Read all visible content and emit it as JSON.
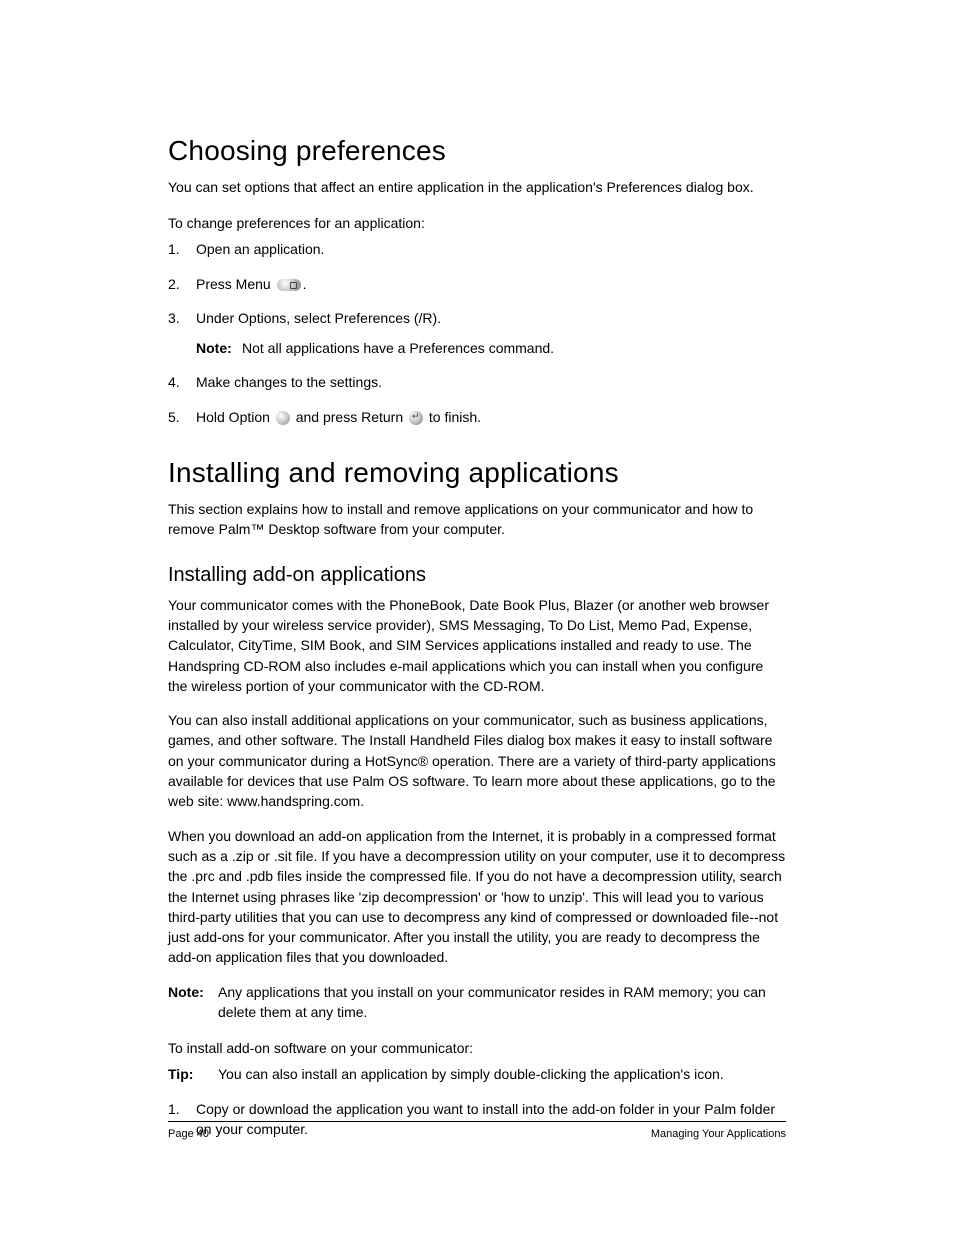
{
  "section1": {
    "heading": "Choosing preferences",
    "intro": "You can set options that affect an entire application in the application's Preferences dialog box.",
    "proc_head": "To change preferences for an application:",
    "steps": {
      "s1": {
        "num": "1.",
        "text": "Open an application."
      },
      "s2": {
        "num": "2.",
        "pre": "Press Menu ",
        "post": "."
      },
      "s3": {
        "num": "3.",
        "text": "Under Options, select Preferences (/R).",
        "note_label": "Note:",
        "note_text": "Not all applications have a Preferences command."
      },
      "s4": {
        "num": "4.",
        "text": "Make changes to the settings."
      },
      "s5": {
        "num": "5.",
        "pre": "Hold Option ",
        "mid": " and press Return ",
        "post": " to finish."
      }
    }
  },
  "section2": {
    "heading": "Installing and removing applications",
    "intro": "This section explains how to install and remove applications on your communicator and how to remove Palm™ Desktop software from your computer.",
    "sub1": {
      "heading": "Installing add-on applications",
      "p1": "Your communicator comes with the PhoneBook, Date Book Plus, Blazer (or another web browser installed by your wireless service provider), SMS Messaging, To Do List, Memo Pad, Expense, Calculator, CityTime, SIM Book, and SIM Services applications installed and ready to use. The Handspring CD-ROM also includes e-mail applications which you can install when you configure the wireless portion of your communicator with the CD-ROM.",
      "p2": "You can also install additional applications on your communicator, such as business applications, games, and other software. The Install Handheld Files dialog box makes it easy to install software on your communicator during a HotSync® operation. There are a variety of third-party applications available for devices that use Palm OS software. To learn more about these applications, go to the web site: www.handspring.com.",
      "p3": "When you download an add-on application from the Internet, it is probably in a compressed format such as a .zip or .sit file. If you have a decompression utility on your computer, use it to decompress the .prc and .pdb files inside the compressed file. If you do not have a decompression utility, search the Internet using phrases like 'zip decompression' or 'how to unzip'. This will lead you to various third-party utilities that you can use to decompress any kind of compressed or downloaded file--not just add-ons for your communicator. After you install the utility, you are ready to decompress the add-on application files that you downloaded.",
      "note_label": "Note:",
      "note_text": "Any applications that you install on your communicator resides in RAM memory; you can delete them at any time.",
      "proc_head": "To install add-on software on your communicator:",
      "tip_label": "Tip:",
      "tip_text": "You can also install an application by simply double-clicking the application's icon.",
      "step1_num": "1.",
      "step1_text": "Copy or download the application you want to install into the add-on folder in your Palm folder on your computer."
    }
  },
  "footer": {
    "left": "Page 40",
    "right": "Managing Your Applications"
  },
  "icons": {
    "menu": "menu-key-icon",
    "option": "option-key-icon",
    "return": "return-key-icon"
  }
}
